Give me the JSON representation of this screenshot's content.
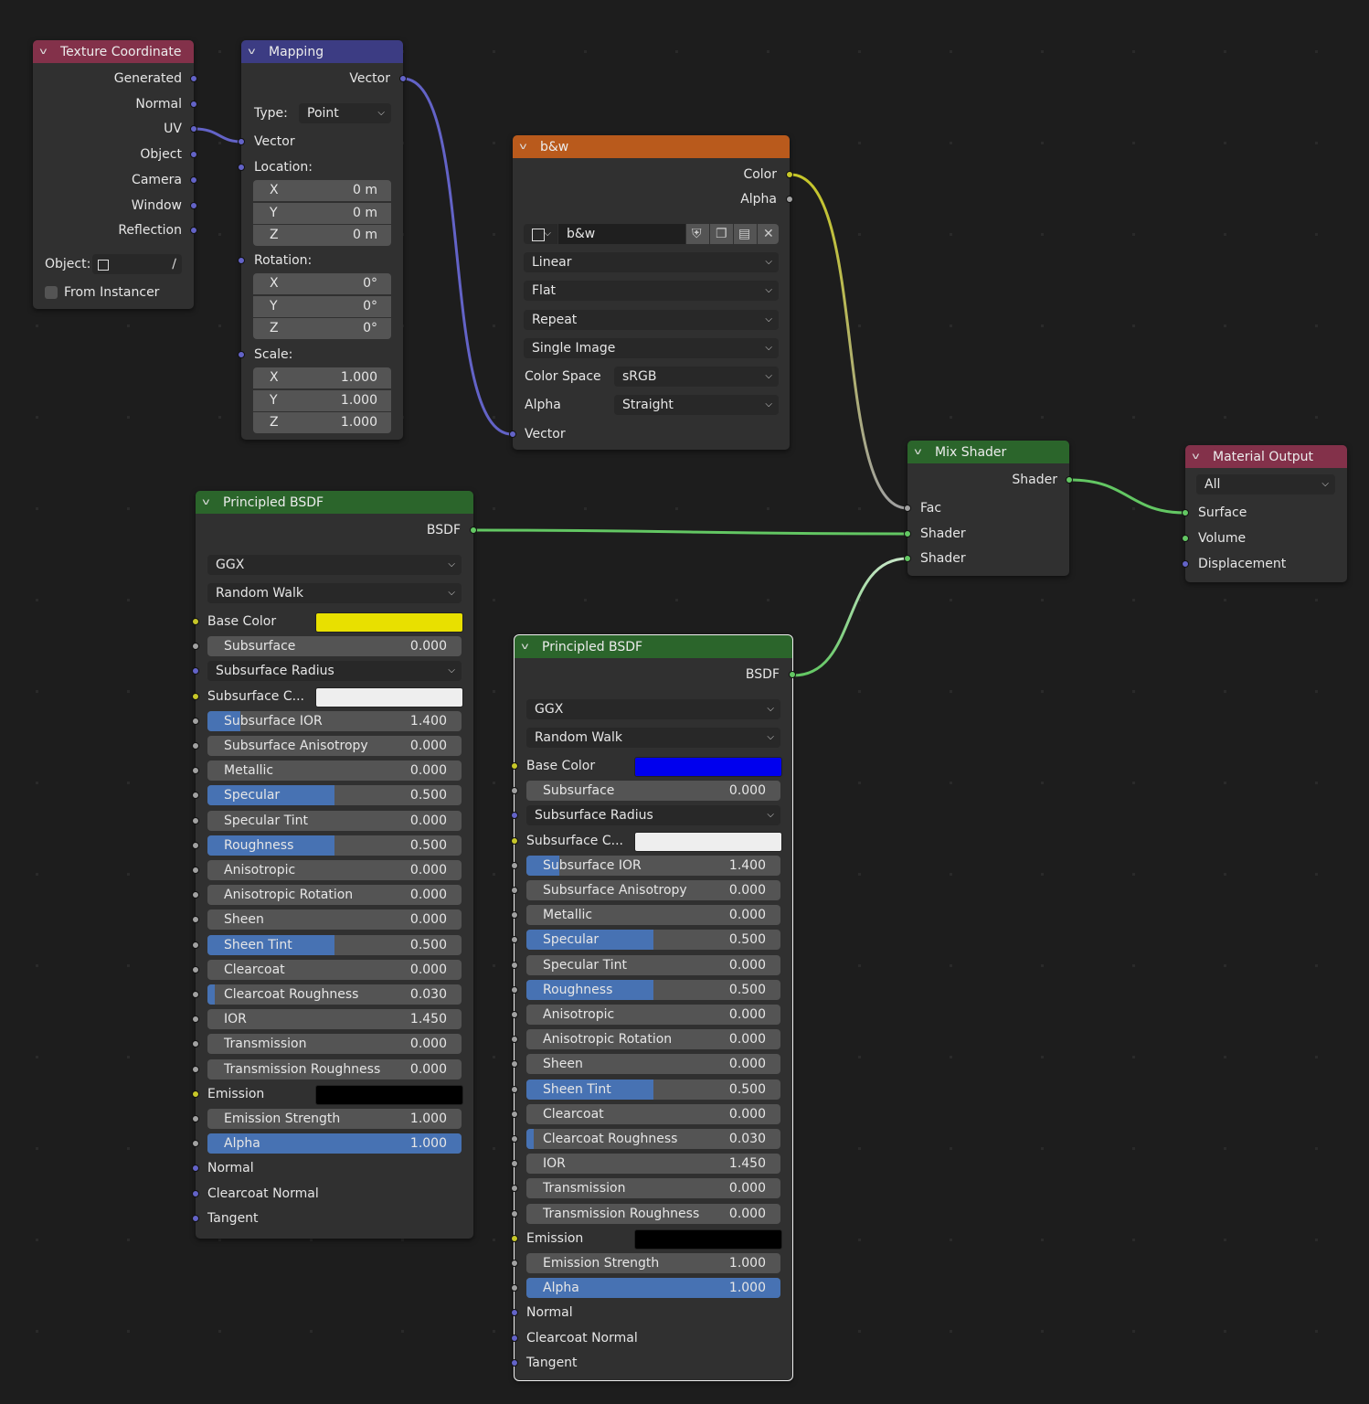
{
  "colors": {
    "background": "#1d1d1d",
    "node_body": "#303030",
    "header_input": "#83314a",
    "header_vector": "#3c3c83",
    "header_texture": "#e06c1a",
    "header_shader": "#2b652b",
    "header_output": "#83314a",
    "socket_vector": "#6363c7",
    "socket_color": "#c7c729",
    "socket_float": "#a1a1a1",
    "socket_shader": "#63c763",
    "slider_fill": "#4772b3"
  },
  "texture_coordinate": {
    "title": "Texture Coordinate",
    "outputs": [
      "Generated",
      "Normal",
      "UV",
      "Object",
      "Camera",
      "Window",
      "Reflection"
    ],
    "object_label": "Object:",
    "from_instancer_label": "From Instancer"
  },
  "mapping": {
    "title": "Mapping",
    "output_vector": "Vector",
    "type_label": "Type:",
    "type_value": "Point",
    "input_vector": "Vector",
    "location_label": "Location:",
    "location": [
      {
        "axis": "X",
        "value": "0 m"
      },
      {
        "axis": "Y",
        "value": "0 m"
      },
      {
        "axis": "Z",
        "value": "0 m"
      }
    ],
    "rotation_label": "Rotation:",
    "rotation": [
      {
        "axis": "X",
        "value": "0°"
      },
      {
        "axis": "Y",
        "value": "0°"
      },
      {
        "axis": "Z",
        "value": "0°"
      }
    ],
    "scale_label": "Scale:",
    "scale": [
      {
        "axis": "X",
        "value": "1.000"
      },
      {
        "axis": "Y",
        "value": "1.000"
      },
      {
        "axis": "Z",
        "value": "1.000"
      }
    ]
  },
  "image_texture": {
    "title": "b&w",
    "output_color": "Color",
    "output_alpha": "Alpha",
    "image_name": "b&w",
    "interpolation": "Linear",
    "projection": "Flat",
    "extension": "Repeat",
    "source": "Single Image",
    "color_space_label": "Color Space",
    "color_space_value": "sRGB",
    "alpha_label": "Alpha",
    "alpha_value": "Straight",
    "input_vector": "Vector"
  },
  "mix_shader": {
    "title": "Mix Shader",
    "output": "Shader",
    "fac": "Fac",
    "shader1": "Shader",
    "shader2": "Shader"
  },
  "material_output": {
    "title": "Material Output",
    "target": "All",
    "surface": "Surface",
    "volume": "Volume",
    "displacement": "Displacement"
  },
  "bsdf1": {
    "title": "Principled BSDF",
    "output": "BSDF",
    "distribution": "GGX",
    "subsurface_method": "Random Walk",
    "base_color_label": "Base Color",
    "base_color": "#e8e000",
    "subsurface_color_label": "Subsurface C...",
    "subsurface_color": "#eeeeee",
    "subsurface_radius_label": "Subsurface Radius",
    "emission_label": "Emission",
    "emission_color": "#000000",
    "sliders": [
      {
        "label": "Subsurface",
        "value": "0.000",
        "fraction": 0
      },
      {
        "label": "Subsurface IOR",
        "value": "1.400",
        "fraction": 0.13
      },
      {
        "label": "Subsurface Anisotropy",
        "value": "0.000",
        "fraction": 0
      },
      {
        "label": "Metallic",
        "value": "0.000",
        "fraction": 0
      },
      {
        "label": "Specular",
        "value": "0.500",
        "fraction": 0.5
      },
      {
        "label": "Specular Tint",
        "value": "0.000",
        "fraction": 0
      },
      {
        "label": "Roughness",
        "value": "0.500",
        "fraction": 0.5
      },
      {
        "label": "Anisotropic",
        "value": "0.000",
        "fraction": 0
      },
      {
        "label": "Anisotropic Rotation",
        "value": "0.000",
        "fraction": 0
      },
      {
        "label": "Sheen",
        "value": "0.000",
        "fraction": 0
      },
      {
        "label": "Sheen Tint",
        "value": "0.500",
        "fraction": 0.5
      },
      {
        "label": "Clearcoat",
        "value": "0.000",
        "fraction": 0
      },
      {
        "label": "Clearcoat Roughness",
        "value": "0.030",
        "fraction": 0.03
      },
      {
        "label": "IOR",
        "value": "1.450",
        "fraction": 0
      },
      {
        "label": "Transmission",
        "value": "0.000",
        "fraction": 0
      },
      {
        "label": "Transmission Roughness",
        "value": "0.000",
        "fraction": 0
      },
      {
        "label": "Emission Strength",
        "value": "1.000",
        "fraction": 0
      },
      {
        "label": "Alpha",
        "value": "1.000",
        "fraction": 1
      }
    ],
    "vector_inputs": [
      "Normal",
      "Clearcoat Normal",
      "Tangent"
    ]
  },
  "bsdf2": {
    "title": "Principled BSDF",
    "output": "BSDF",
    "distribution": "GGX",
    "subsurface_method": "Random Walk",
    "base_color_label": "Base Color",
    "base_color": "#0000ee",
    "subsurface_color_label": "Subsurface C...",
    "subsurface_color": "#eeeeee",
    "subsurface_radius_label": "Subsurface Radius",
    "emission_label": "Emission",
    "emission_color": "#000000",
    "sliders": [
      {
        "label": "Subsurface",
        "value": "0.000",
        "fraction": 0
      },
      {
        "label": "Subsurface IOR",
        "value": "1.400",
        "fraction": 0.13
      },
      {
        "label": "Subsurface Anisotropy",
        "value": "0.000",
        "fraction": 0
      },
      {
        "label": "Metallic",
        "value": "0.000",
        "fraction": 0
      },
      {
        "label": "Specular",
        "value": "0.500",
        "fraction": 0.5
      },
      {
        "label": "Specular Tint",
        "value": "0.000",
        "fraction": 0
      },
      {
        "label": "Roughness",
        "value": "0.500",
        "fraction": 0.5
      },
      {
        "label": "Anisotropic",
        "value": "0.000",
        "fraction": 0
      },
      {
        "label": "Anisotropic Rotation",
        "value": "0.000",
        "fraction": 0
      },
      {
        "label": "Sheen",
        "value": "0.000",
        "fraction": 0
      },
      {
        "label": "Sheen Tint",
        "value": "0.500",
        "fraction": 0.5
      },
      {
        "label": "Clearcoat",
        "value": "0.000",
        "fraction": 0
      },
      {
        "label": "Clearcoat Roughness",
        "value": "0.030",
        "fraction": 0.03
      },
      {
        "label": "IOR",
        "value": "1.450",
        "fraction": 0
      },
      {
        "label": "Transmission",
        "value": "0.000",
        "fraction": 0
      },
      {
        "label": "Transmission Roughness",
        "value": "0.000",
        "fraction": 0
      },
      {
        "label": "Emission Strength",
        "value": "1.000",
        "fraction": 0
      },
      {
        "label": "Alpha",
        "value": "1.000",
        "fraction": 1
      }
    ],
    "vector_inputs": [
      "Normal",
      "Clearcoat Normal",
      "Tangent"
    ]
  }
}
